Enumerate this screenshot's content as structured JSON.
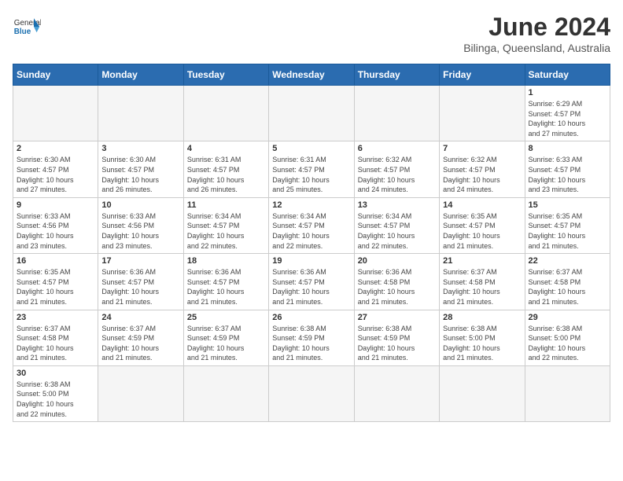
{
  "header": {
    "logo_general": "General",
    "logo_blue": "Blue",
    "month_title": "June 2024",
    "location": "Bilinga, Queensland, Australia"
  },
  "days_of_week": [
    "Sunday",
    "Monday",
    "Tuesday",
    "Wednesday",
    "Thursday",
    "Friday",
    "Saturday"
  ],
  "weeks": [
    [
      {
        "num": "",
        "info": "",
        "empty": true
      },
      {
        "num": "",
        "info": "",
        "empty": true
      },
      {
        "num": "",
        "info": "",
        "empty": true
      },
      {
        "num": "",
        "info": "",
        "empty": true
      },
      {
        "num": "",
        "info": "",
        "empty": true
      },
      {
        "num": "",
        "info": "",
        "empty": true
      },
      {
        "num": "1",
        "info": "Sunrise: 6:29 AM\nSunset: 4:57 PM\nDaylight: 10 hours\nand 27 minutes.",
        "empty": false
      }
    ],
    [
      {
        "num": "2",
        "info": "Sunrise: 6:30 AM\nSunset: 4:57 PM\nDaylight: 10 hours\nand 27 minutes.",
        "empty": false
      },
      {
        "num": "3",
        "info": "Sunrise: 6:30 AM\nSunset: 4:57 PM\nDaylight: 10 hours\nand 26 minutes.",
        "empty": false
      },
      {
        "num": "4",
        "info": "Sunrise: 6:31 AM\nSunset: 4:57 PM\nDaylight: 10 hours\nand 26 minutes.",
        "empty": false
      },
      {
        "num": "5",
        "info": "Sunrise: 6:31 AM\nSunset: 4:57 PM\nDaylight: 10 hours\nand 25 minutes.",
        "empty": false
      },
      {
        "num": "6",
        "info": "Sunrise: 6:32 AM\nSunset: 4:57 PM\nDaylight: 10 hours\nand 24 minutes.",
        "empty": false
      },
      {
        "num": "7",
        "info": "Sunrise: 6:32 AM\nSunset: 4:57 PM\nDaylight: 10 hours\nand 24 minutes.",
        "empty": false
      },
      {
        "num": "8",
        "info": "Sunrise: 6:33 AM\nSunset: 4:57 PM\nDaylight: 10 hours\nand 23 minutes.",
        "empty": false
      }
    ],
    [
      {
        "num": "9",
        "info": "Sunrise: 6:33 AM\nSunset: 4:56 PM\nDaylight: 10 hours\nand 23 minutes.",
        "empty": false
      },
      {
        "num": "10",
        "info": "Sunrise: 6:33 AM\nSunset: 4:56 PM\nDaylight: 10 hours\nand 23 minutes.",
        "empty": false
      },
      {
        "num": "11",
        "info": "Sunrise: 6:34 AM\nSunset: 4:57 PM\nDaylight: 10 hours\nand 22 minutes.",
        "empty": false
      },
      {
        "num": "12",
        "info": "Sunrise: 6:34 AM\nSunset: 4:57 PM\nDaylight: 10 hours\nand 22 minutes.",
        "empty": false
      },
      {
        "num": "13",
        "info": "Sunrise: 6:34 AM\nSunset: 4:57 PM\nDaylight: 10 hours\nand 22 minutes.",
        "empty": false
      },
      {
        "num": "14",
        "info": "Sunrise: 6:35 AM\nSunset: 4:57 PM\nDaylight: 10 hours\nand 21 minutes.",
        "empty": false
      },
      {
        "num": "15",
        "info": "Sunrise: 6:35 AM\nSunset: 4:57 PM\nDaylight: 10 hours\nand 21 minutes.",
        "empty": false
      }
    ],
    [
      {
        "num": "16",
        "info": "Sunrise: 6:35 AM\nSunset: 4:57 PM\nDaylight: 10 hours\nand 21 minutes.",
        "empty": false
      },
      {
        "num": "17",
        "info": "Sunrise: 6:36 AM\nSunset: 4:57 PM\nDaylight: 10 hours\nand 21 minutes.",
        "empty": false
      },
      {
        "num": "18",
        "info": "Sunrise: 6:36 AM\nSunset: 4:57 PM\nDaylight: 10 hours\nand 21 minutes.",
        "empty": false
      },
      {
        "num": "19",
        "info": "Sunrise: 6:36 AM\nSunset: 4:57 PM\nDaylight: 10 hours\nand 21 minutes.",
        "empty": false
      },
      {
        "num": "20",
        "info": "Sunrise: 6:36 AM\nSunset: 4:58 PM\nDaylight: 10 hours\nand 21 minutes.",
        "empty": false
      },
      {
        "num": "21",
        "info": "Sunrise: 6:37 AM\nSunset: 4:58 PM\nDaylight: 10 hours\nand 21 minutes.",
        "empty": false
      },
      {
        "num": "22",
        "info": "Sunrise: 6:37 AM\nSunset: 4:58 PM\nDaylight: 10 hours\nand 21 minutes.",
        "empty": false
      }
    ],
    [
      {
        "num": "23",
        "info": "Sunrise: 6:37 AM\nSunset: 4:58 PM\nDaylight: 10 hours\nand 21 minutes.",
        "empty": false
      },
      {
        "num": "24",
        "info": "Sunrise: 6:37 AM\nSunset: 4:59 PM\nDaylight: 10 hours\nand 21 minutes.",
        "empty": false
      },
      {
        "num": "25",
        "info": "Sunrise: 6:37 AM\nSunset: 4:59 PM\nDaylight: 10 hours\nand 21 minutes.",
        "empty": false
      },
      {
        "num": "26",
        "info": "Sunrise: 6:38 AM\nSunset: 4:59 PM\nDaylight: 10 hours\nand 21 minutes.",
        "empty": false
      },
      {
        "num": "27",
        "info": "Sunrise: 6:38 AM\nSunset: 4:59 PM\nDaylight: 10 hours\nand 21 minutes.",
        "empty": false
      },
      {
        "num": "28",
        "info": "Sunrise: 6:38 AM\nSunset: 5:00 PM\nDaylight: 10 hours\nand 21 minutes.",
        "empty": false
      },
      {
        "num": "29",
        "info": "Sunrise: 6:38 AM\nSunset: 5:00 PM\nDaylight: 10 hours\nand 22 minutes.",
        "empty": false
      }
    ],
    [
      {
        "num": "30",
        "info": "Sunrise: 6:38 AM\nSunset: 5:00 PM\nDaylight: 10 hours\nand 22 minutes.",
        "empty": false
      },
      {
        "num": "",
        "info": "",
        "empty": true
      },
      {
        "num": "",
        "info": "",
        "empty": true
      },
      {
        "num": "",
        "info": "",
        "empty": true
      },
      {
        "num": "",
        "info": "",
        "empty": true
      },
      {
        "num": "",
        "info": "",
        "empty": true
      },
      {
        "num": "",
        "info": "",
        "empty": true
      }
    ]
  ]
}
